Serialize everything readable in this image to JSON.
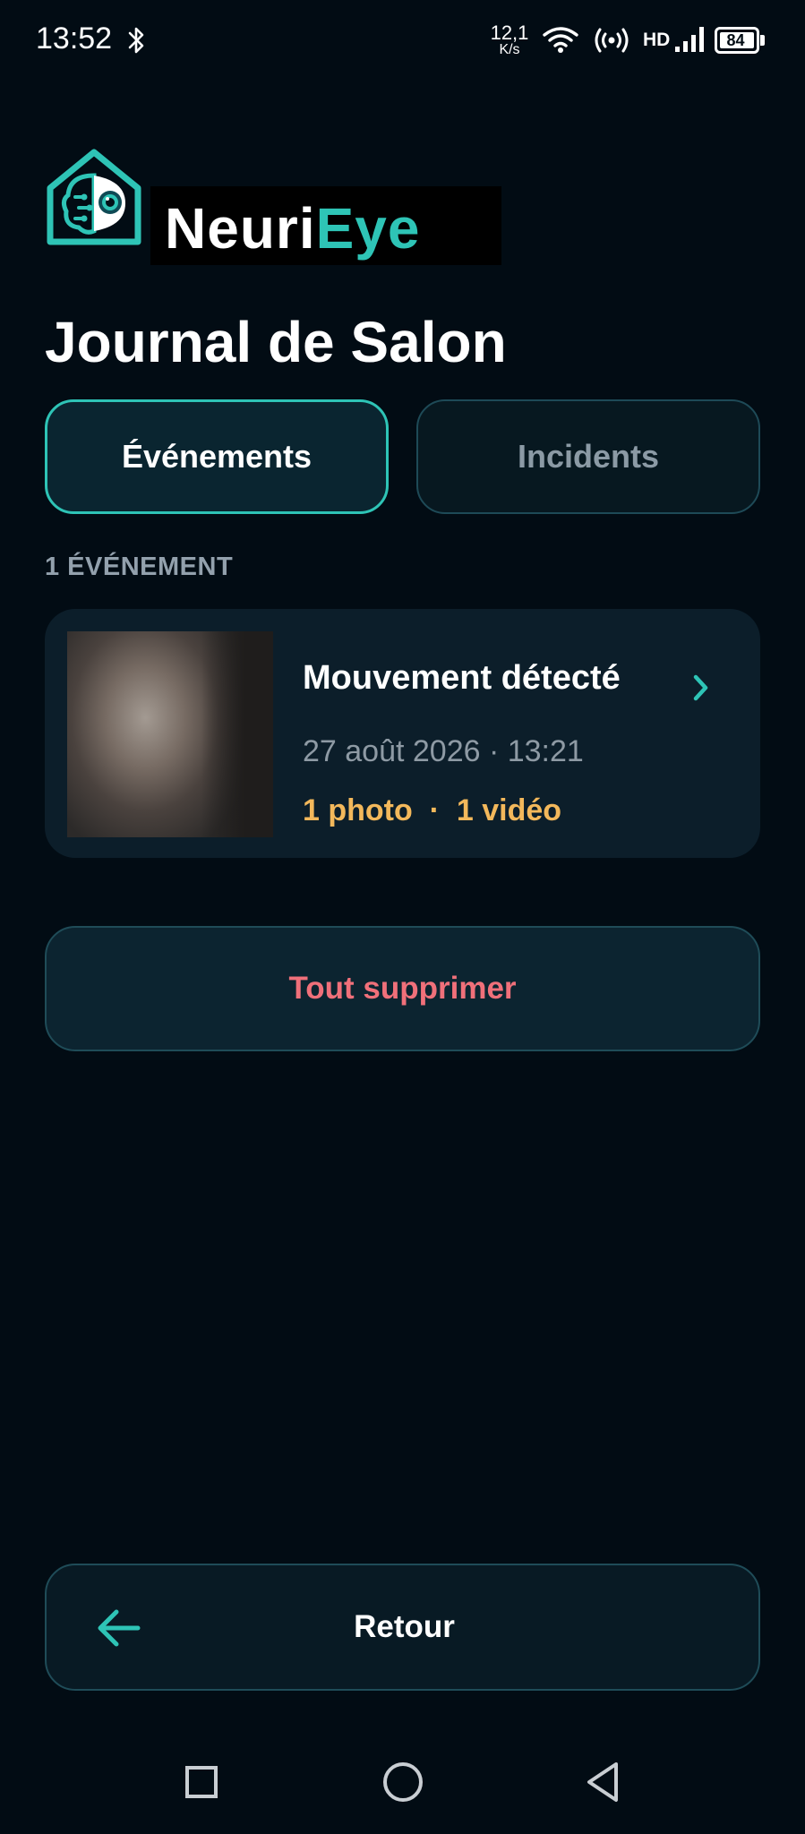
{
  "status_bar": {
    "time": "13:52",
    "net_speed_value": "12,1",
    "net_speed_unit": "K/s",
    "network_label": "HD",
    "battery_level": "84",
    "icons": [
      "bluetooth-icon",
      "wifi-icon",
      "hotspot-icon",
      "signal-icon",
      "battery-icon"
    ]
  },
  "logo": {
    "wordmark_part1": "Neuri",
    "wordmark_part2": "Eye",
    "colors": {
      "accent": "#2ec4b6",
      "wordmark_white": "#ffffff"
    }
  },
  "page": {
    "title": "Journal de Salon"
  },
  "tabs": [
    {
      "label": "Événements",
      "active": true
    },
    {
      "label": "Incidents",
      "active": false
    }
  ],
  "events": {
    "count_label": "1 ÉVÉNEMENT",
    "items": [
      {
        "title": "Mouvement détecté",
        "datetime": "27 août 2026 · 13:21",
        "media_summary": "1 photo  ·  1 vidéo",
        "icon": "chevron-right-icon"
      }
    ]
  },
  "actions": {
    "delete_all_label": "Tout supprimer",
    "back_label": "Retour",
    "back_icon": "arrow-left-icon"
  },
  "nav_bar": {
    "icons": [
      "recent-apps-icon",
      "home-icon",
      "back-icon"
    ]
  },
  "colors": {
    "background": "#020c14",
    "accent": "#2ec4b6",
    "media_highlight": "#f3b85b",
    "danger": "#f0707a",
    "muted_text": "#8e9aa4"
  }
}
